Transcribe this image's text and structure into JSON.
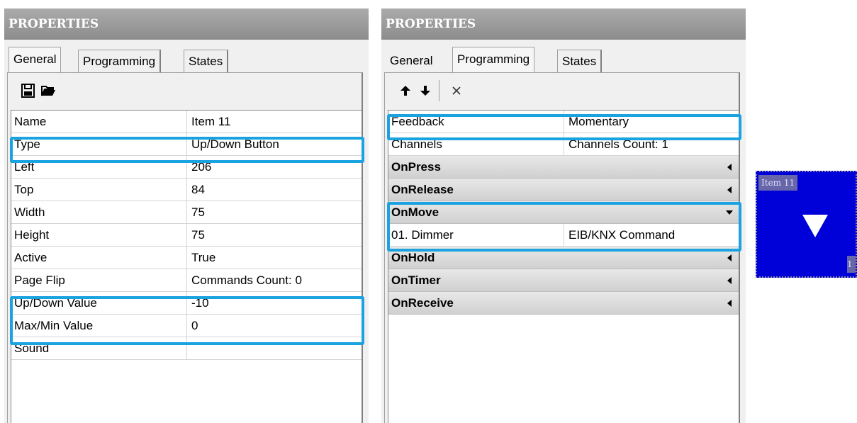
{
  "left_panel": {
    "title": "PROPERTIES",
    "tabs": [
      "General",
      "Programming",
      "States"
    ],
    "toolbar": [
      "save-icon",
      "open-folder-icon"
    ],
    "rows": [
      {
        "name": "Name",
        "value": "Item 11"
      },
      {
        "name": "Type",
        "value": "Up/Down Button"
      },
      {
        "name": "Left",
        "value": "206"
      },
      {
        "name": "Top",
        "value": "84"
      },
      {
        "name": "Width",
        "value": "75"
      },
      {
        "name": "Height",
        "value": "75"
      },
      {
        "name": "Active",
        "value": "True"
      },
      {
        "name": "Page Flip",
        "value": "Commands Count: 0"
      },
      {
        "name": "Up/Down Value",
        "value": "-10"
      },
      {
        "name": "Max/Min Value",
        "value": "0"
      },
      {
        "name": "Sound",
        "value": ""
      }
    ]
  },
  "right_panel": {
    "title": "PROPERTIES",
    "tabs": [
      "General",
      "Programming",
      "States"
    ],
    "toolbar": [
      "arrow-up-icon",
      "arrow-down-icon",
      "delete-x-icon"
    ],
    "rows": [
      {
        "name": "Feedback",
        "value": "Momentary"
      },
      {
        "name": "Channels",
        "value": "Channels Count: 1"
      }
    ],
    "groups": [
      {
        "label": "OnPress"
      },
      {
        "label": "OnRelease"
      },
      {
        "label": "OnMove",
        "expanded": true,
        "child": {
          "name": "01. Dimmer",
          "value": "EIB/KNX Command"
        }
      },
      {
        "label": "OnHold"
      },
      {
        "label": "OnTimer"
      },
      {
        "label": "OnReceive"
      }
    ]
  },
  "preview": {
    "label": "Item 11",
    "corner_text": "1",
    "background": "#0000d8",
    "icon": "down-triangle-icon"
  },
  "highlight_color": "#1aa3e0"
}
